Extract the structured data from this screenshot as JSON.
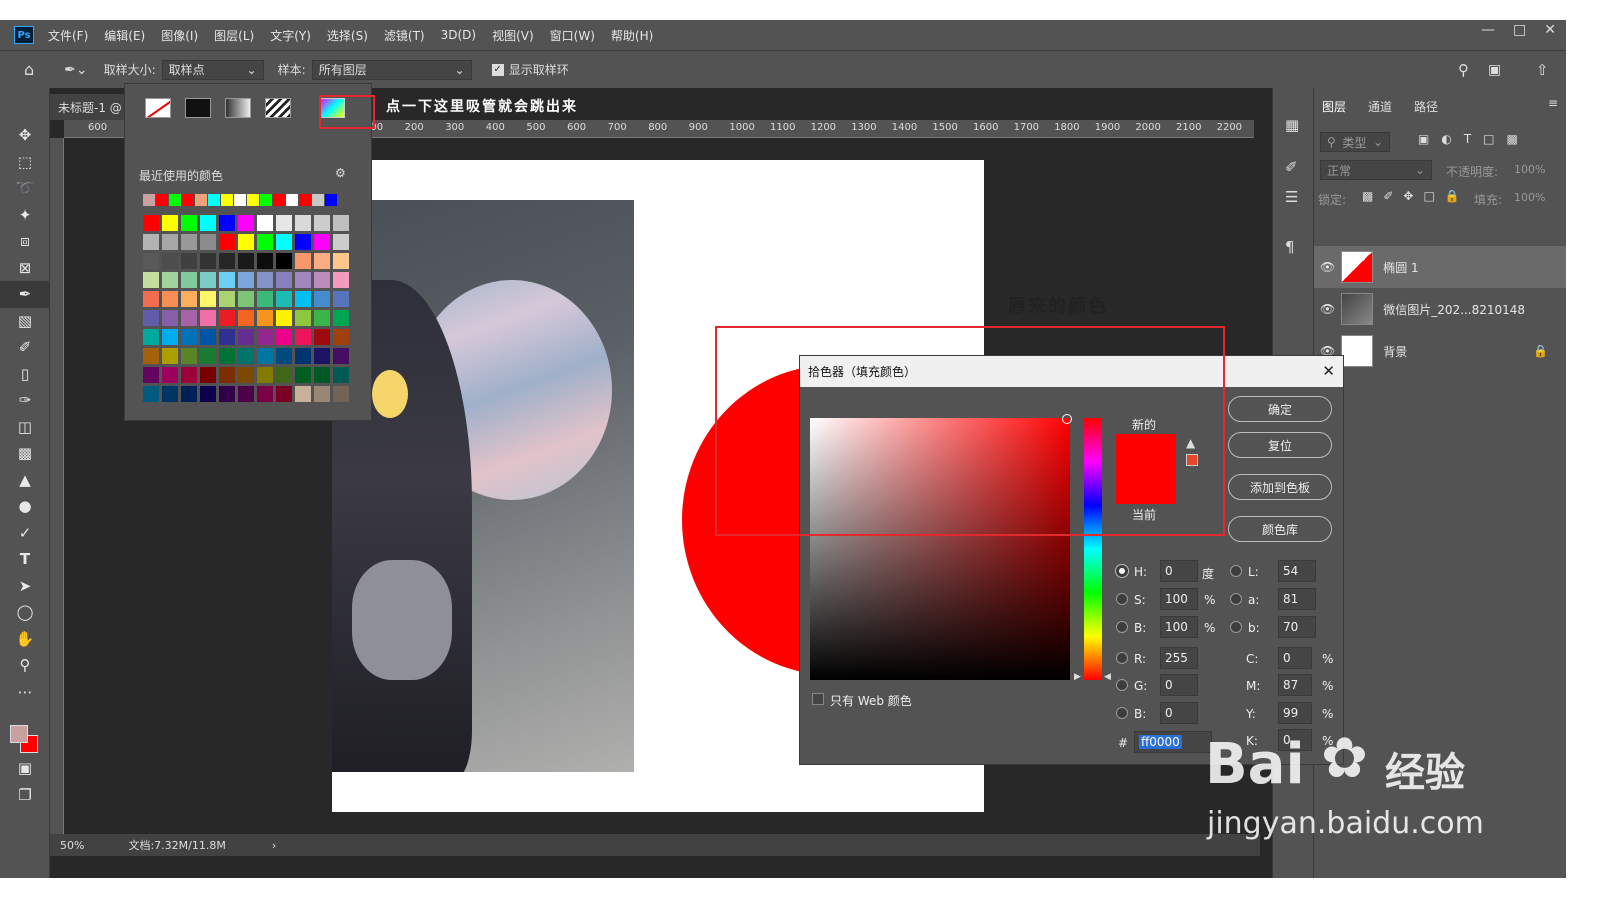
{
  "menubar": {
    "logo": "Ps",
    "items": [
      "文件(F)",
      "编辑(E)",
      "图像(I)",
      "图层(L)",
      "文字(Y)",
      "选择(S)",
      "滤镜(T)",
      "3D(D)",
      "视图(V)",
      "窗口(W)",
      "帮助(H)"
    ]
  },
  "options": {
    "sample_size_label": "取样大小:",
    "sample_size_value": "取样点",
    "sample_label": "样本:",
    "sample_value": "所有图层",
    "show_ring_label": "显示取样环"
  },
  "document": {
    "tab_title": "未标题-1 @",
    "zoom": "50%",
    "doc_info": "文档:7.32M/11.8M"
  },
  "ruler_ticks": [
    "600",
    "100",
    "200",
    "300",
    "400",
    "500",
    "600",
    "700",
    "800",
    "900",
    "1000",
    "1100",
    "1200",
    "1300",
    "1400",
    "1500",
    "1600",
    "1700",
    "1800",
    "1900",
    "2000",
    "2100",
    "2200"
  ],
  "swatch_popup": {
    "recent_label": "最近使用的颜色",
    "recent_colors": [
      "#c8a0a0",
      "#ff0000",
      "#00ff00",
      "#ff0000",
      "#f2a07a",
      "#00ffff",
      "#ffff00",
      "#ffffff",
      "#ffff00",
      "#00ff00",
      "#ff0000",
      "#ffffff",
      "#ff0000",
      "#c8c8c8",
      "#0000ff"
    ],
    "grid_colors": [
      "#ff0000",
      "#ffff00",
      "#00ff00",
      "#00ffff",
      "#0000ff",
      "#ff00ff",
      "#ffffff",
      "#e6e6e6",
      "#d9d9d9",
      "#cccccc",
      "#bfbfbf",
      "#b3b3b3",
      "#a6a6a6",
      "#999999",
      "#8c8c8c",
      "#ff0000",
      "#ffff00",
      "#00ff00",
      "#00ffff",
      "#0000ff",
      "#ff00ff",
      "#cccccc",
      "#595959",
      "#4d4d4d",
      "#404040",
      "#333333",
      "#262626",
      "#1a1a1a",
      "#0d0d0d",
      "#000000",
      "#f7976a",
      "#f9ad81",
      "#fdc68a",
      "#c4df9b",
      "#a3d39c",
      "#82ca9c",
      "#7accc8",
      "#6dcff6",
      "#7da7d9",
      "#8393ca",
      "#8781bd",
      "#a187be",
      "#bd8cbf",
      "#f49ac1",
      "#f26c4f",
      "#f68e56",
      "#fbaf5d",
      "#fff568",
      "#acd373",
      "#7cc576",
      "#3cb878",
      "#1cbbb4",
      "#00bff3",
      "#448ccb",
      "#5574b9",
      "#605ca8",
      "#855fa8",
      "#a863a8",
      "#f06eaa",
      "#ed1c24",
      "#f26522",
      "#f7941d",
      "#fff200",
      "#8dc73f",
      "#39b54a",
      "#00a651",
      "#00a99d",
      "#00aeef",
      "#0072bc",
      "#0054a6",
      "#2e3192",
      "#662d91",
      "#92278f",
      "#ec008c",
      "#ed145b",
      "#9e0b0f",
      "#a0410d",
      "#a36209",
      "#aba000",
      "#598527",
      "#197b30",
      "#007236",
      "#00746b",
      "#0076a3",
      "#004a80",
      "#003471",
      "#1b1464",
      "#440e62",
      "#630460",
      "#9e005d",
      "#9e0039",
      "#790000",
      "#7b2e00",
      "#7d4900",
      "#827b00",
      "#406618",
      "#005e20",
      "#005826",
      "#005952",
      "#005b7f",
      "#003663",
      "#002157",
      "#0d004c",
      "#32004b",
      "#4b0049",
      "#7b0046",
      "#7a0026",
      "#c7b299",
      "#998675",
      "#736357",
      "#534741",
      "#37302d",
      "#c69c6d",
      "#a67c52"
    ]
  },
  "annotations": {
    "tip": "点一下这里吸管就会跳出来",
    "original_color": "原来的颜色"
  },
  "color_picker": {
    "title": "拾色器（填充颜色）",
    "new_label": "新的",
    "current_label": "当前",
    "buttons": [
      "确定",
      "复位",
      "添加到色板",
      "颜色库"
    ],
    "web_only_label": "只有 Web 颜色",
    "hsb": [
      {
        "label": "H:",
        "value": "0",
        "unit": "度",
        "selected": true
      },
      {
        "label": "S:",
        "value": "100",
        "unit": "%",
        "selected": false
      },
      {
        "label": "B:",
        "value": "100",
        "unit": "%",
        "selected": false
      }
    ],
    "lab": [
      {
        "label": "L:",
        "value": "54"
      },
      {
        "label": "a:",
        "value": "81"
      },
      {
        "label": "b:",
        "value": "70"
      }
    ],
    "rgb": [
      {
        "label": "R:",
        "value": "255"
      },
      {
        "label": "G:",
        "value": "0"
      },
      {
        "label": "B:",
        "value": "0"
      }
    ],
    "cmyk": [
      {
        "label": "C:",
        "value": "0",
        "unit": "%"
      },
      {
        "label": "M:",
        "value": "87",
        "unit": "%"
      },
      {
        "label": "Y:",
        "value": "99",
        "unit": "%"
      },
      {
        "label": "K:",
        "value": "0",
        "unit": "%"
      }
    ],
    "hex_label": "#",
    "hex_value": "ff0000",
    "new_color": "#ff0000",
    "current_color": "#ff0000"
  },
  "layers_panel": {
    "tabs": [
      "图层",
      "通道",
      "路径"
    ],
    "filter_label": "类型",
    "blend_mode": "正常",
    "opacity_label": "不透明度:",
    "opacity_value": "100%",
    "lock_label": "锁定:",
    "fill_label": "填充:",
    "fill_value": "100%",
    "layers": [
      {
        "name": "椭圆 1",
        "selected": true
      },
      {
        "name": "微信图片_202...8210148",
        "selected": false
      },
      {
        "name": "背景",
        "selected": false,
        "locked": true
      }
    ]
  },
  "watermark": {
    "brand": "Bai",
    "brand2": "经验",
    "url": "jingyan.baidu.com"
  },
  "colors": {
    "accent_red": "#ff0000",
    "annotation_red": "#e3282e",
    "ui_panel": "#535353",
    "ui_dark": "#282828"
  }
}
